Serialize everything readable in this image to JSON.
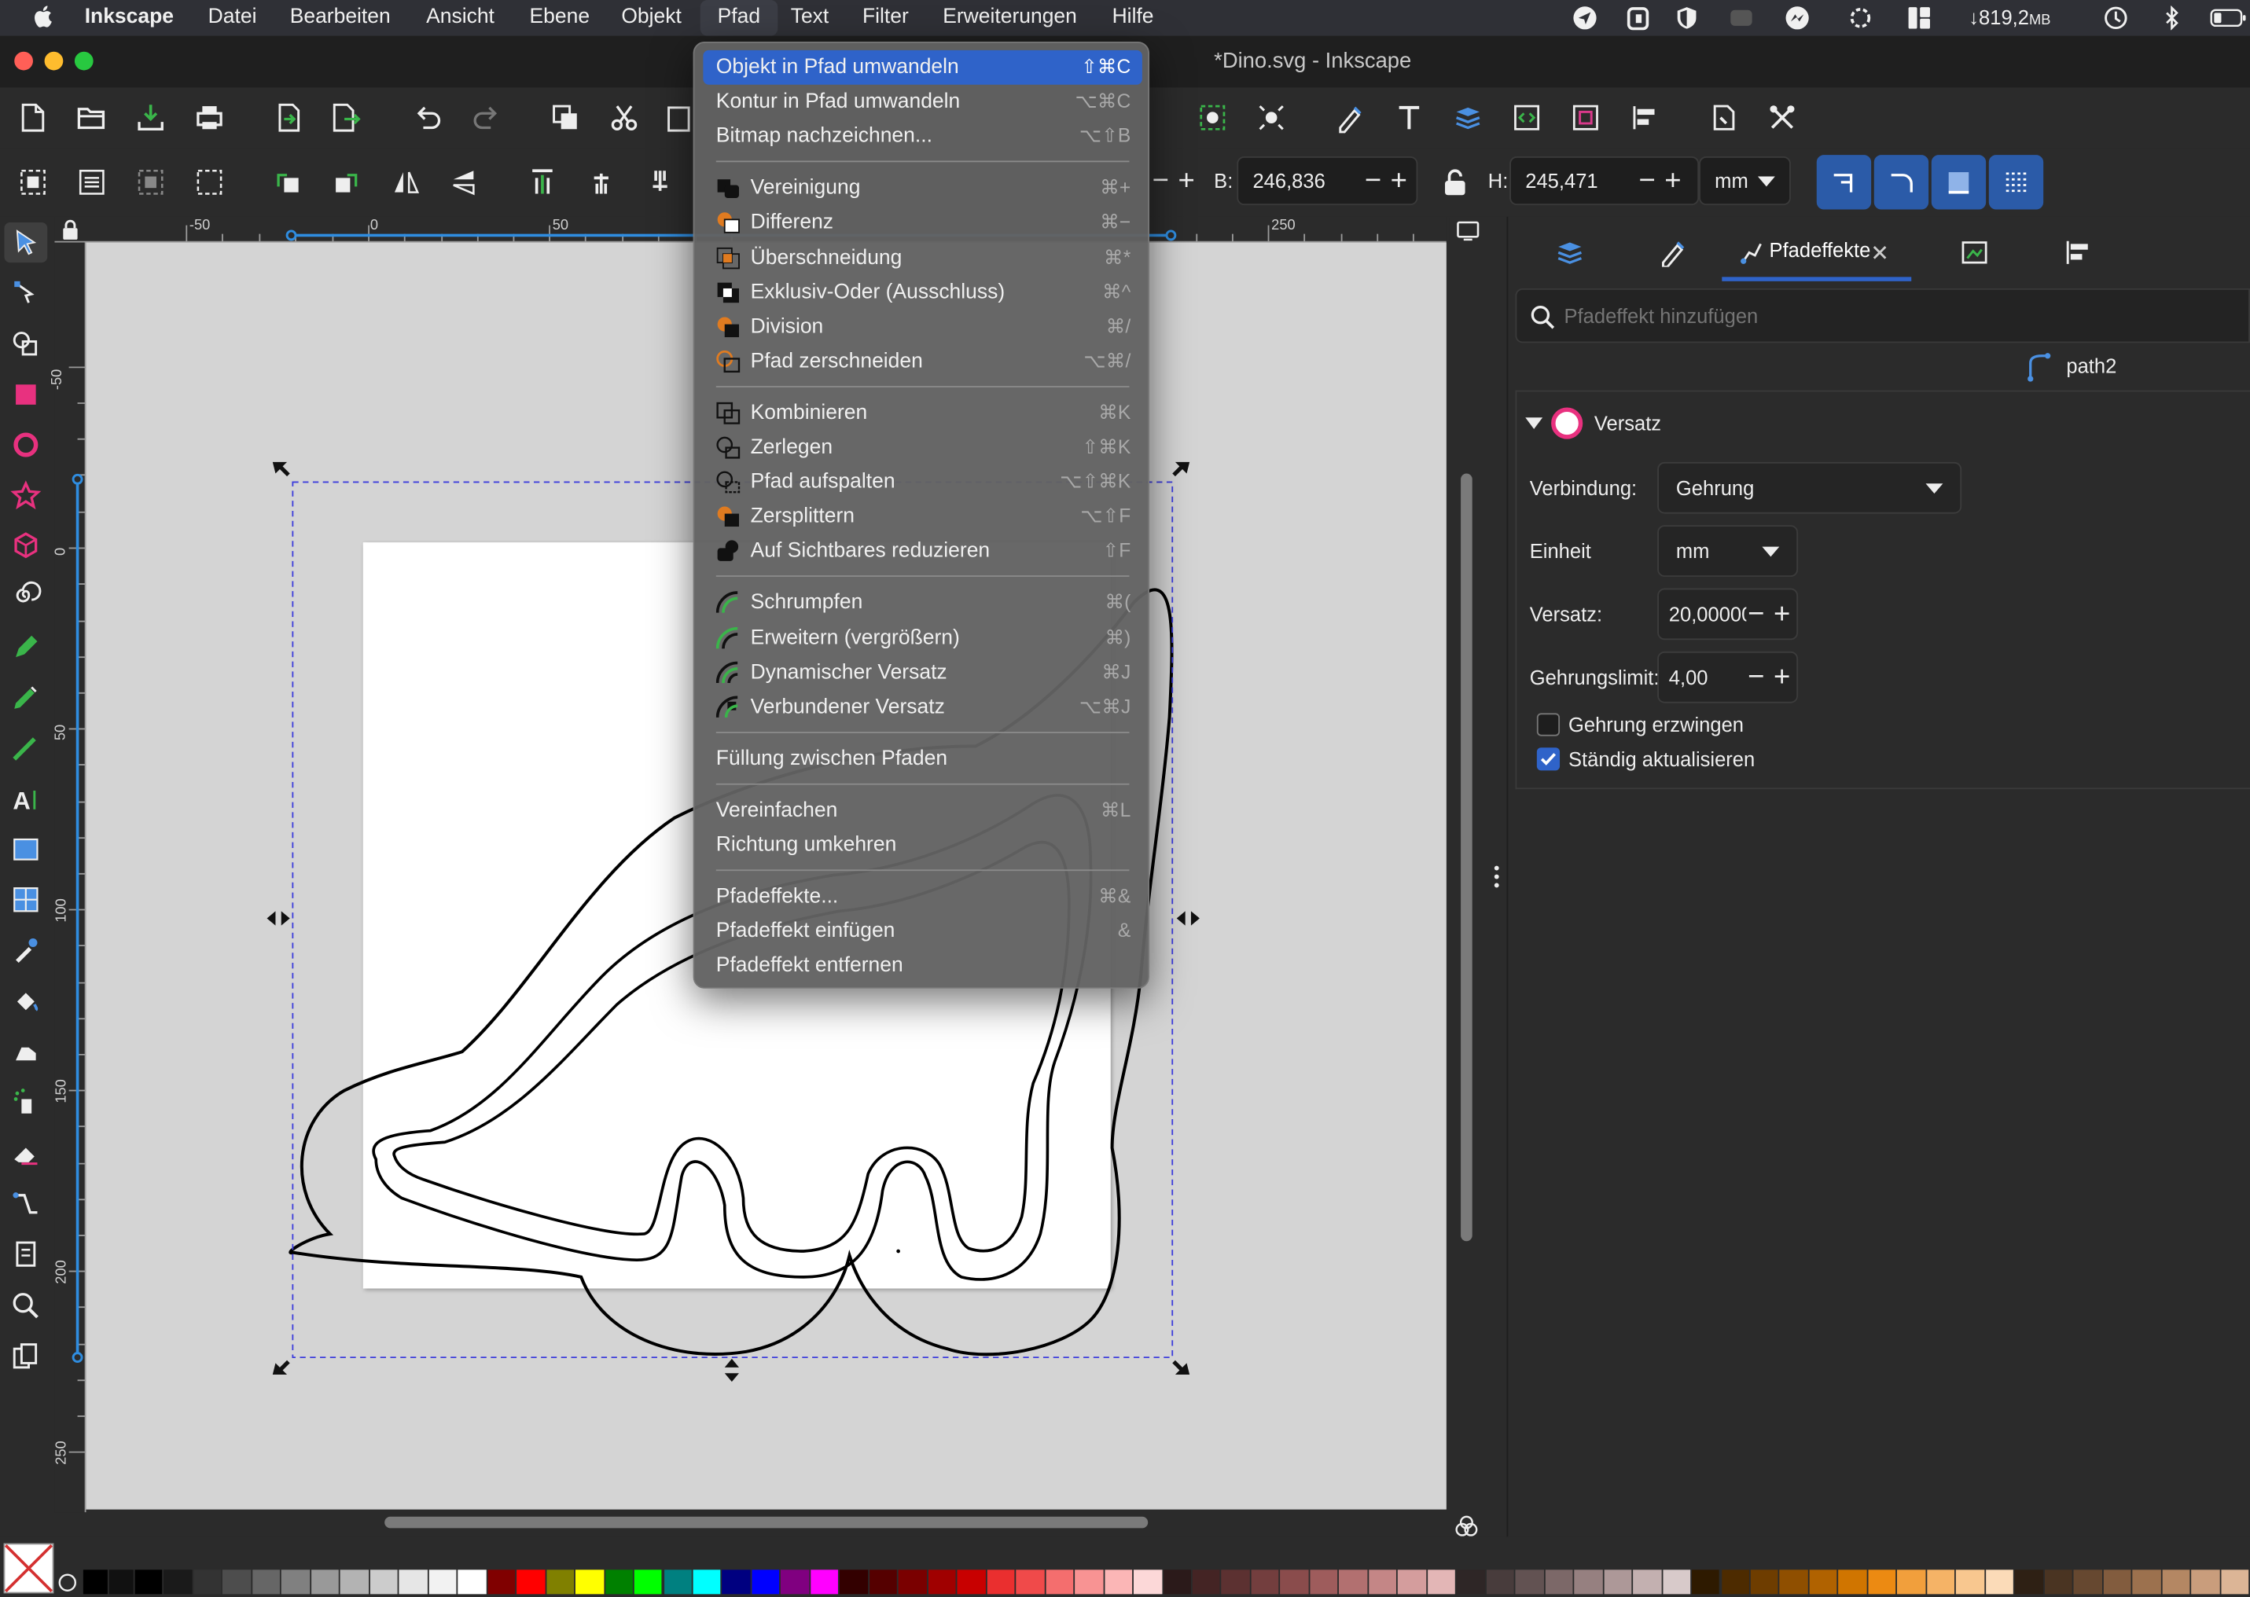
{
  "menubar": {
    "app": "Inkscape",
    "items": [
      "Datei",
      "Bearbeiten",
      "Ansicht",
      "Ebene",
      "Objekt",
      "Pfad",
      "Text",
      "Filter",
      "Erweiterungen",
      "Hilfe"
    ],
    "download_stat": "↓819,2",
    "download_unit": "MB"
  },
  "window": {
    "title": "*Dino.svg - Inkscape"
  },
  "controls": {
    "width_label": "B:",
    "width_value": "246,836",
    "height_label": "H:",
    "height_value": "245,471",
    "unit": "mm"
  },
  "rulers": {
    "h_labels": [
      "-50",
      "0",
      "50",
      "250"
    ],
    "v_labels": [
      "-50",
      "0",
      "50",
      "100",
      "150",
      "200",
      "250"
    ]
  },
  "menu": {
    "items": [
      {
        "label": "Objekt in Pfad umwandeln",
        "shortcut": "⇧⌘C",
        "highlighted": true,
        "icon": ""
      },
      {
        "label": "Kontur in Pfad umwandeln",
        "shortcut": "⌥⌘C",
        "icon": ""
      },
      {
        "label": "Bitmap nachzeichnen...",
        "shortcut": "⌥⇧B",
        "icon": ""
      },
      {
        "sep": true
      },
      {
        "label": "Vereinigung",
        "shortcut": "⌘+",
        "icon": "union-icon"
      },
      {
        "label": "Differenz",
        "shortcut": "⌘−",
        "icon": "difference-icon"
      },
      {
        "label": "Überschneidung",
        "shortcut": "⌘*",
        "icon": "intersection-icon"
      },
      {
        "label": "Exklusiv-Oder (Ausschluss)",
        "shortcut": "⌘^",
        "icon": "exclusion-icon"
      },
      {
        "label": "Division",
        "shortcut": "⌘/",
        "icon": "division-icon"
      },
      {
        "label": "Pfad zerschneiden",
        "shortcut": "⌥⌘/",
        "icon": "cut-path-icon"
      },
      {
        "sep": true
      },
      {
        "label": "Kombinieren",
        "shortcut": "⌘K",
        "icon": "combine-icon"
      },
      {
        "label": "Zerlegen",
        "shortcut": "⇧⌘K",
        "icon": "break-apart-icon"
      },
      {
        "label": "Pfad aufspalten",
        "shortcut": "⌥⇧⌘K",
        "icon": "split-path-icon"
      },
      {
        "label": "Zersplittern",
        "shortcut": "⌥⇧F",
        "icon": "fracture-icon"
      },
      {
        "label": "Auf Sichtbares reduzieren",
        "shortcut": "⇧F",
        "icon": "flatten-icon"
      },
      {
        "sep": true
      },
      {
        "label": "Schrumpfen",
        "shortcut": "⌘(",
        "icon": "inset-icon"
      },
      {
        "label": "Erweitern (vergrößern)",
        "shortcut": "⌘)",
        "icon": "outset-icon"
      },
      {
        "label": "Dynamischer Versatz",
        "shortcut": "⌘J",
        "icon": "dynamic-offset-icon"
      },
      {
        "label": "Verbundener Versatz",
        "shortcut": "⌥⌘J",
        "icon": "linked-offset-icon"
      },
      {
        "sep": true
      },
      {
        "label": "Füllung zwischen Pfaden",
        "shortcut": "",
        "icon": ""
      },
      {
        "sep": true
      },
      {
        "label": "Vereinfachen",
        "shortcut": "⌘L",
        "icon": ""
      },
      {
        "label": "Richtung umkehren",
        "shortcut": "",
        "icon": ""
      },
      {
        "sep": true
      },
      {
        "label": "Pfadeffekte...",
        "shortcut": "⌘&",
        "icon": ""
      },
      {
        "label": "Pfadeffekt einfügen",
        "shortcut": "&",
        "icon": ""
      },
      {
        "label": "Pfadeffekt entfernen",
        "shortcut": "",
        "icon": ""
      }
    ]
  },
  "panel": {
    "tab_active_label": "Pfadeffekte",
    "search_placeholder": "Pfadeffekt hinzufügen",
    "object_name": "path2",
    "effect_name": "Versatz",
    "join_label": "Verbindung:",
    "join_value": "Gehrung",
    "unit_label": "Einheit",
    "unit_value": "mm",
    "offset_label": "Versatz:",
    "offset_value": "20,00000",
    "miter_label": "Gehrungslimit:",
    "miter_value": "4,00",
    "force_miter_label": "Gehrung erzwingen",
    "force_miter_checked": false,
    "live_update_label": "Ständig aktualisieren",
    "live_update_checked": true
  },
  "palette": [
    "#000000",
    "#1a1a1a",
    "#333333",
    "#4d4d4d",
    "#666666",
    "#808080",
    "#999999",
    "#b3b3b3",
    "#cccccc",
    "#e6e6e6",
    "#f2f2f2",
    "#ffffff",
    "#800000",
    "#ff0000",
    "#808000",
    "#ffff00",
    "#008000",
    "#00ff00",
    "#008080",
    "#00ffff",
    "#000080",
    "#0000ff",
    "#800080",
    "#ff00ff",
    "#330000",
    "#550000",
    "#7a0000",
    "#a00000",
    "#c80000",
    "#ea2f2f",
    "#f04a4a",
    "#f46e6e",
    "#f89393",
    "#fbb6b6",
    "#fcd8d8",
    "#2b1a1a",
    "#442424",
    "#5c3131",
    "#733e3e",
    "#8a4c4c",
    "#9e5c5c",
    "#b27070",
    "#c48686",
    "#d49d9d",
    "#e3b6b6",
    "#2e2626",
    "#483c3c",
    "#625252",
    "#7c6868",
    "#968080",
    "#ad9898",
    "#c3b0b0",
    "#d8caca",
    "#2e1a00",
    "#4d2b00",
    "#6e3d00",
    "#8f4f00",
    "#b06200",
    "#d07500",
    "#ec8a12",
    "#f19f3c",
    "#f5b366",
    "#f8c78f",
    "#fbdbb8",
    "#2e2014",
    "#4a3422",
    "#664830",
    "#825c3e",
    "#9c714e",
    "#b48763",
    "#c99d7c",
    "#dcb596"
  ]
}
